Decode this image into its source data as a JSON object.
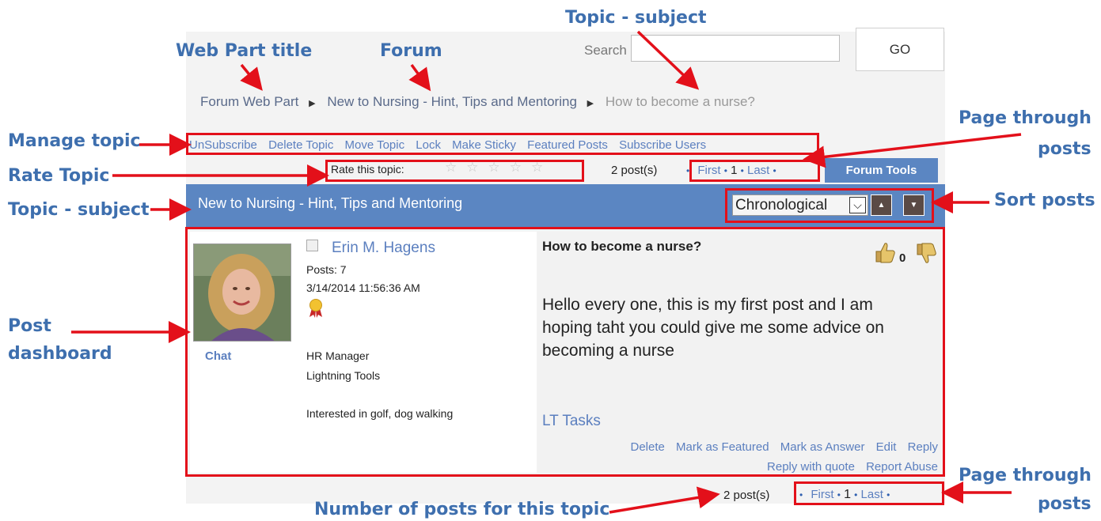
{
  "annotations": {
    "topic_subject_top": "Topic - subject",
    "web_part_title": "Web Part title",
    "forum": "Forum",
    "manage_topic": "Manage topic",
    "rate_topic": "Rate Topic",
    "topic_subject_left": "Topic - subject",
    "post_dashboard_line1": "Post",
    "post_dashboard_line2": "dashboard",
    "page_through_top_line1": "Page through",
    "page_through_top_line2": "posts",
    "sort_posts": "Sort posts",
    "page_through_bottom_line1": "Page through",
    "page_through_bottom_line2": "posts",
    "number_of_posts": "Number of posts for this topic"
  },
  "search": {
    "label": "Search",
    "value": "",
    "go_label": "GO"
  },
  "breadcrumb": {
    "web_part": "Forum Web Part",
    "forum": "New to Nursing - Hint, Tips and Mentoring",
    "topic": "How to become a nurse?"
  },
  "manage_links": [
    "UnSubscribe",
    "Delete Topic",
    "Move Topic",
    "Lock",
    "Make Sticky",
    "Featured Posts",
    "Subscribe Users"
  ],
  "rating": {
    "label": "Rate this topic:",
    "stars_max": 5,
    "stars_filled": 0
  },
  "post_count_top": "2 post(s)",
  "pager_top": {
    "first": "First",
    "page": "1",
    "last": "Last"
  },
  "forum_tools_label": "Forum Tools",
  "topic_bar_title": "New to Nursing - Hint, Tips and Mentoring",
  "sort": {
    "selected": "Chronological"
  },
  "post": {
    "author": "Erin M. Hagens",
    "posts": "Posts: 7",
    "date": "3/14/2014 11:56:36 AM",
    "chat": "Chat",
    "role": "HR Manager",
    "company": "Lightning Tools",
    "interests": "Interested in golf, dog walking",
    "title": "How to become a nurse?",
    "vote_count": "0",
    "body": "Hello every one, this is my first post and I am hoping taht you could give me some advice on becoming a nurse",
    "tasks_label": "LT Tasks",
    "actions_row1": [
      "Delete",
      "Mark as Featured",
      "Mark as Answer",
      "Edit",
      "Reply"
    ],
    "actions_row2": [
      "Reply with quote",
      "Report Abuse"
    ]
  },
  "post_count_bottom": "2 post(s)",
  "pager_bottom": {
    "first": "First",
    "page": "1",
    "last": "Last"
  },
  "colors": {
    "annotation_text": "#3e6fae",
    "annotation_red": "#e3101a",
    "topic_bar": "#5b86c2",
    "link": "#5b7fbf"
  },
  "icons": [
    "chevron-right-icon",
    "star-icon",
    "chevron-down-icon",
    "arrow-up-icon",
    "arrow-down-icon",
    "thumbs-up-icon",
    "thumbs-down-icon",
    "award-ribbon-icon",
    "checkbox-icon"
  ]
}
